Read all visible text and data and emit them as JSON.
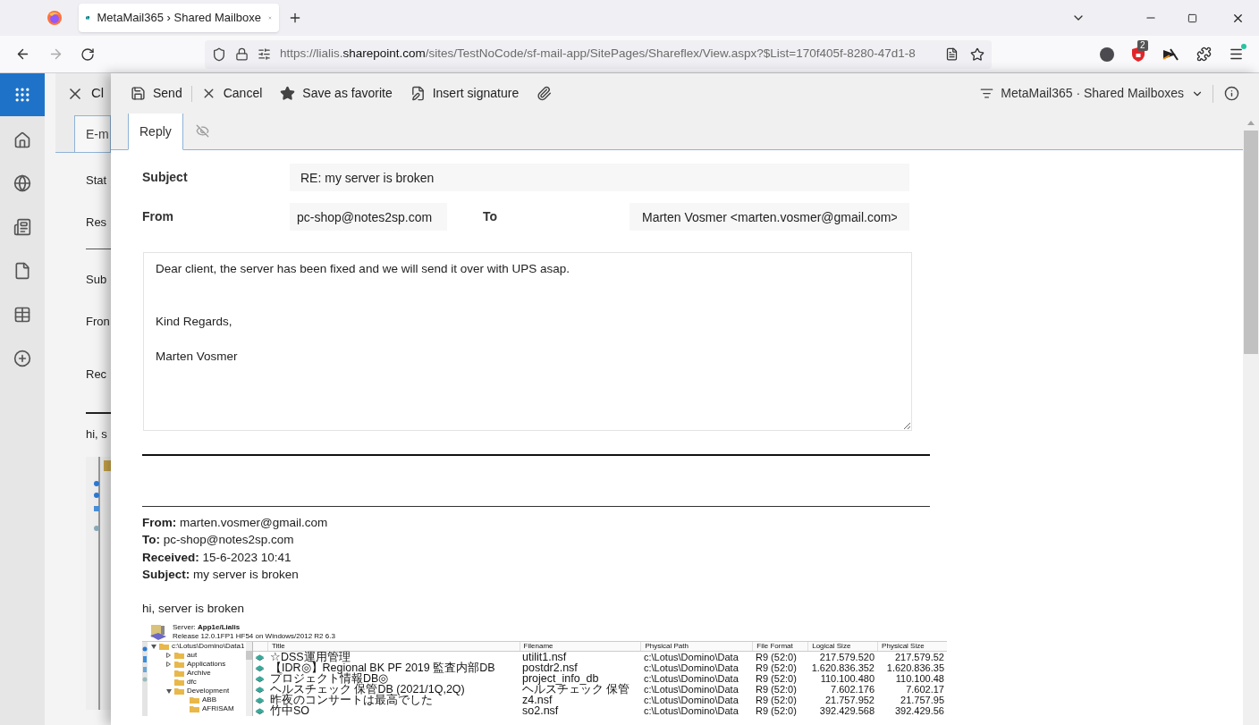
{
  "browser": {
    "tabs": [
      {
        "title": "MetaMail365 › Shared Mailboxe",
        "selected": true
      }
    ],
    "url": {
      "prefix": "https://lialis.",
      "domain": "sharepoint.com",
      "rest": "/sites/TestNoCode/sf-mail-app/SitePages/Shareflex/View.aspx?$List=170f405f-8280-47d1-8"
    },
    "extension_badge": "2"
  },
  "background_page": {
    "close_label": "Cl",
    "tab_label": "E-m",
    "field_labels": [
      "Stat",
      "Res",
      "Sub",
      "Fron",
      "Rec"
    ],
    "body": "hi, s"
  },
  "dialog": {
    "toolbar": [
      {
        "kind": "save",
        "label": "Send"
      },
      {
        "kind": "cancel",
        "label": "Cancel"
      },
      {
        "kind": "favorite",
        "label": "Save as favorite"
      },
      {
        "kind": "signature",
        "label": "Insert signature"
      },
      {
        "kind": "attach"
      }
    ],
    "site_switcher": "MetaMail365 · Shared Mailboxes",
    "tabs": [
      {
        "kind": "text",
        "label": "Reply",
        "selected": true
      },
      {
        "kind": "hidden",
        "selected": false
      }
    ],
    "subject": {
      "label": "Subject",
      "value": "RE: my server is broken"
    },
    "from": {
      "label": "From",
      "value": "pc-shop@notes2sp.com"
    },
    "to": {
      "label": "To",
      "value": "Marten Vosmer <marten.vosmer@gmail.com>"
    },
    "body": "Dear client, the server has been fixed and we will send it over with UPS asap.\n\n\nKind Regards,\n\nMarten Vosmer",
    "quoted_header": [
      "**From:** marten.vosmer@gmail.com",
      "**To:** pc-shop@notes2sp.com",
      "**Received:** 15-6-2023 10:41",
      "**Subject:** my server is broken"
    ],
    "quoted_body": "hi, server is broken",
    "screenshot": {
      "server": "Server: **App1e/Lialis**",
      "release": "Release 12.0.1FP1 HF54 on Windows/2012 R2 6.3",
      "tree": [
        {
          "label": "c:\\Lotus\\Domino\\Data1",
          "expanded": true,
          "children": [
            {
              "label": "aut",
              "expanded": false
            },
            {
              "label": "Applications",
              "expanded": false
            },
            {
              "label": "Archive"
            },
            {
              "label": "dfc"
            },
            {
              "label": "Development",
              "expanded": true,
              "children": [
                {
                  "label": "ABB"
                },
                {
                  "label": "AFRISAM"
                }
              ]
            }
          ]
        }
      ],
      "columns": [
        "Title",
        "Filename",
        "Physical Path",
        "File Format",
        "Logical Size",
        "Physical Size"
      ],
      "rows": [
        [
          "☆DSS運用管理",
          "utilit1.nsf",
          "c:\\Lotus\\Domino\\Data",
          "R9 (52:0)",
          "217.579.520",
          "217.579.52"
        ],
        [
          "【IDR◎】Regional BK PF 2019 監査内部DB",
          "postdr2.nsf",
          "c:\\Lotus\\Domino\\Data",
          "R9 (52:0)",
          "1.620.836.352",
          "1.620.836.35"
        ],
        [
          "プロジェクト情報DB◎",
          "project_info_db",
          "c:\\Lotus\\Domino\\Data",
          "R9 (52:0)",
          "110.100.480",
          "110.100.48"
        ],
        [
          "ヘルスチェック 保管DB (2021/1Q,2Q)",
          "ヘルスチェック 保管",
          "c:\\Lotus\\Domino\\Data",
          "R9 (52:0)",
          "7.602.176",
          "7.602.17"
        ],
        [
          "昨夜のコンサートは最高でした",
          "z4.nsf",
          "c:\\Lotus\\Domino\\Data",
          "R9 (52:0)",
          "21.757.952",
          "21.757.95"
        ],
        [
          "竹中SO",
          "so2.nsf",
          "c:\\Lotus\\Domino\\Data",
          "R9 (52:0)",
          "392.429.568",
          "392.429.56"
        ]
      ]
    }
  }
}
